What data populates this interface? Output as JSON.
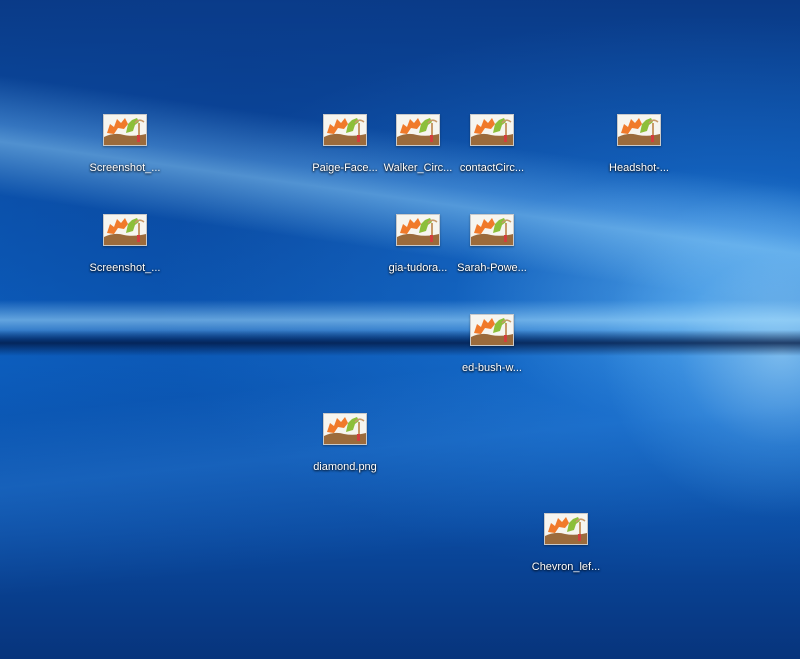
{
  "desktop": {
    "icons": [
      {
        "label": "Screenshot_...",
        "icon": "image-file-icon"
      },
      {
        "label": "Screenshot_...",
        "icon": "image-file-icon"
      },
      {
        "label": "Paige-Face...",
        "icon": "image-file-icon"
      },
      {
        "label": "Walker_Circ...",
        "icon": "image-file-icon"
      },
      {
        "label": "contactCirc...",
        "icon": "image-file-icon"
      },
      {
        "label": "Headshot-...",
        "icon": "image-file-icon"
      },
      {
        "label": "gia-tudora...",
        "icon": "image-file-icon"
      },
      {
        "label": "Sarah-Powe...",
        "icon": "image-file-icon"
      },
      {
        "label": "ed-bush-w...",
        "icon": "image-file-icon"
      },
      {
        "label": "diamond.png",
        "icon": "image-file-icon"
      },
      {
        "label": "Chevron_lef...",
        "icon": "image-file-icon"
      }
    ]
  },
  "colors": {
    "wallpaper": "#0b58b6",
    "label_text": "#ffffff",
    "thumb_orange": "#f07a2a",
    "thumb_green": "#8cbf3a",
    "thumb_brown": "#9b6b3c"
  }
}
